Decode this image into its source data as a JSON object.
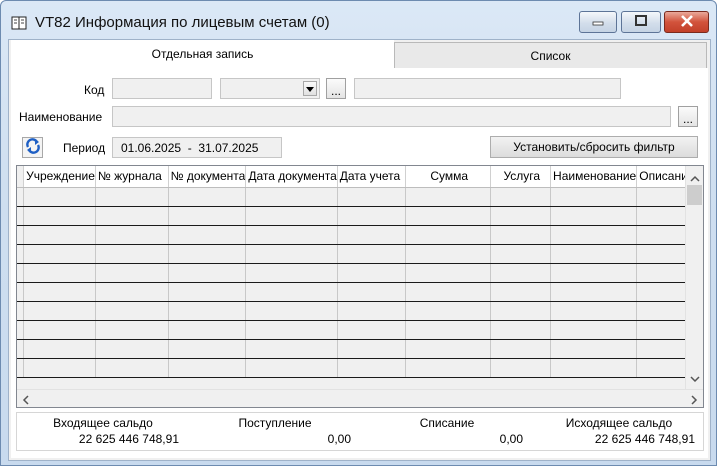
{
  "window": {
    "title": "VT82 Информация по лицевым счетам (0)"
  },
  "tabs": [
    {
      "label": "Отдельная запись",
      "active": true
    },
    {
      "label": "Список",
      "active": false
    }
  ],
  "filters": {
    "code_label": "Код",
    "code_value": "",
    "name_label": "Наименование",
    "name_value": "",
    "browse_label": "...",
    "period_label": "Период",
    "period_value": "01.06.2025  -  31.07.2025",
    "filter_button": "Установить/сбросить фильтр"
  },
  "table": {
    "columns": [
      "Учреждение",
      "№ журнала",
      "№ документа",
      "Дата документа",
      "Дата учета",
      "Сумма",
      "Услуга",
      "Наименование",
      "Описание"
    ],
    "row_count": 10
  },
  "totals": [
    {
      "label": "Входящее сальдо",
      "value": "22 625 446 748,91"
    },
    {
      "label": "Поступление",
      "value": "0,00"
    },
    {
      "label": "Списание",
      "value": "0,00"
    },
    {
      "label": "Исходящее сальдо",
      "value": "22 625 446 748,91"
    }
  ],
  "colors": {
    "accent": "#1e5fc4",
    "close_button": "#c7452f"
  }
}
